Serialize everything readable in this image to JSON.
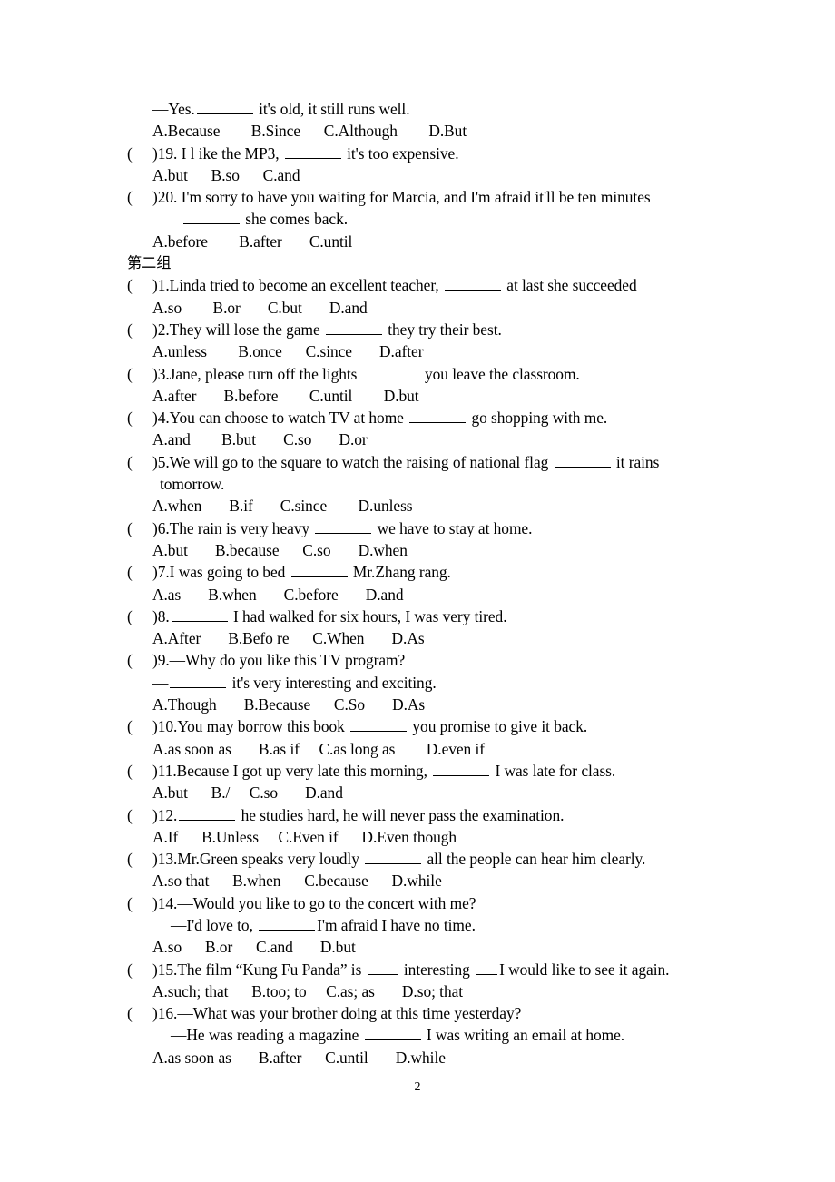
{
  "document": {
    "page_number": "2",
    "section_heading": "第二组"
  },
  "group_one_tail": {
    "q18_answer_line": "—Yes.",
    "q18_answer_tail": " it's old, it still runs well.",
    "q18_options": "A.Because        B.Since      C.Although        D.But",
    "q19": {
      "marker": "(",
      "number": ")19. I l ike the MP3, ",
      "tail": " it's too expensive.",
      "options": "A.but      B.so      C.and"
    },
    "q20": {
      "marker": "(",
      "number": ")20. I'm sorry to have you waiting for Marcia, and I'm afraid it'll be ten minutes",
      "continuation_tail": " she comes back.",
      "options": "A.before        B.after       C.until"
    }
  },
  "group_two": [
    {
      "marker": "(",
      "stem_pre": ")1.Linda tried to become an excellent teacher, ",
      "stem_post": " at last she succeeded",
      "options": "A.so        B.or       C.but       D.and"
    },
    {
      "marker": "(",
      "stem_pre": ")2.They will lose the game ",
      "stem_post": " they try their best.",
      "options": "A.unless        B.once      C.since       D.after"
    },
    {
      "marker": "(",
      "stem_pre": ")3.Jane, please turn off the lights ",
      "stem_post": " you leave the classroom.",
      "options": "A.after       B.before        C.until        D.but"
    },
    {
      "marker": "(",
      "stem_pre": ")4.You can choose to watch TV at home ",
      "stem_post": " go shopping with me.",
      "options": "A.and        B.but       C.so       D.or"
    },
    {
      "marker": "(",
      "stem_pre": ")5.We will go to the square to watch the raising of national flag ",
      "stem_post": " it rains",
      "continuation": "tomorrow.",
      "options": "A.when       B.if       C.since        D.unless"
    },
    {
      "marker": "(",
      "stem_pre": ")6.The rain is very heavy ",
      "stem_post": " we have to stay at home.",
      "options": "A.but       B.because      C.so       D.when"
    },
    {
      "marker": "(",
      "stem_pre": ")7.I was going to bed ",
      "stem_post": " Mr.Zhang rang.",
      "options": "A.as       B.when       C.before       D.and"
    },
    {
      "marker": "(",
      "stem_pre": ")8.",
      "stem_post": " I had walked for six hours, I was very tired.",
      "options": "A.After       B.Befo re      C.When       D.As"
    },
    {
      "marker": "(",
      "stem_pre": ")9.—Why do you like this TV program?",
      "stem_post": "",
      "reply_pre": "—",
      "reply_post": " it's very interesting and exciting.",
      "options": "A.Though       B.Because      C.So       D.As"
    },
    {
      "marker": "(",
      "stem_pre": ")10.You may borrow this book ",
      "stem_post": " you promise to give it back.",
      "options": "A.as soon as       B.as if     C.as long as        D.even if"
    },
    {
      "marker": "(",
      "stem_pre": ")11.Because I got up very late this morning, ",
      "stem_post": " I was late for class.",
      "options": "A.but      B./     C.so       D.and"
    },
    {
      "marker": "(",
      "stem_pre": ")12.",
      "stem_post": " he studies hard, he will never pass the examination.",
      "options": "A.If      B.Unless     C.Even if      D.Even though"
    },
    {
      "marker": "(",
      "stem_pre": ")13.Mr.Green speaks very loudly ",
      "stem_post": " all the people can hear him clearly.",
      "options": "A.so that      B.when      C.because      D.while"
    },
    {
      "marker": "(",
      "stem_pre": ")14.—Would you like to go to the concert with me?",
      "stem_post": "",
      "reply_pre": "—I'd love to, ",
      "reply_post": "I'm afraid I have no time.",
      "options": "A.so      B.or      C.and       D.but"
    },
    {
      "marker": "(",
      "stem_pre": ")15.The film “Kung Fu Panda” is ",
      "stem_mid": " interesting ",
      "stem_post": "I would like to see it again.",
      "options": "A.such; that      B.too; to     C.as; as       D.so; that"
    },
    {
      "marker": "(",
      "stem_pre": ")16.—What was your brother doing at this time yesterday?",
      "stem_post": "",
      "reply_pre": "—He was reading a magazine ",
      "reply_post": " I was writing an email at home.",
      "options": "A.as soon as       B.after      C.until       D.while"
    }
  ]
}
